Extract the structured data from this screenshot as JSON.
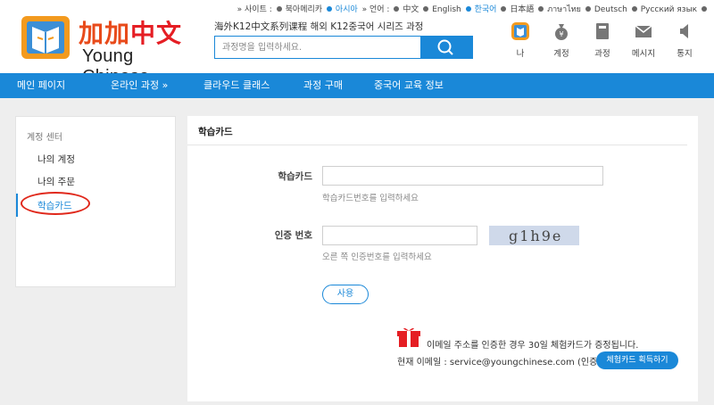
{
  "langbar": {
    "site_label": "» 사이트 :",
    "sites": [
      "북아메리카",
      "아시아"
    ],
    "lang_label": "» 언어 :",
    "languages": [
      "中文",
      "English",
      "한국어",
      "日本語",
      "ภาษาไทย",
      "Deutsch",
      "Русский язык"
    ]
  },
  "logo": {
    "cn": [
      "加",
      "加",
      "中",
      "文"
    ],
    "en": "Young Chinese"
  },
  "header": {
    "tagline": "海外K12中文系列课程 해외 K12중국어 시리즈 과정",
    "search_placeholder": "과정명을 입력하세요."
  },
  "iconbar": [
    {
      "label": "나",
      "icon": "user-avatar-icon"
    },
    {
      "label": "계정",
      "icon": "money-bag-icon"
    },
    {
      "label": "과정",
      "icon": "book-icon"
    },
    {
      "label": "메시지",
      "icon": "envelope-icon"
    },
    {
      "label": "통지",
      "icon": "speaker-icon"
    }
  ],
  "nav": [
    "메인 페이지",
    "온라인 과정 »",
    "클라우드 클래스",
    "과정 구매",
    "중국어 교육 정보"
  ],
  "sidebar": {
    "title": "계정 센터",
    "items": [
      "나의 계정",
      "나의 주문",
      "학습카드"
    ]
  },
  "main": {
    "title": "학습카드",
    "card_label": "학습카드",
    "card_hint": "학습카드번호를 입력하세요",
    "code_label": "인증 번호",
    "code_hint": "오른 쪽 인증번호를 입력하세요",
    "captcha_text": "g1h9e",
    "use_button": "사용",
    "promo": "이메일 주소를 인증한 경우 30일 체험카드가 증정됩니다.",
    "email_line": "현재 이메일 : service@youngchinese.com (인증됨)",
    "claim_button": "체험카드 획득하기"
  },
  "colors": {
    "accent": "#1a88d8",
    "highlight": "#e0281b"
  }
}
